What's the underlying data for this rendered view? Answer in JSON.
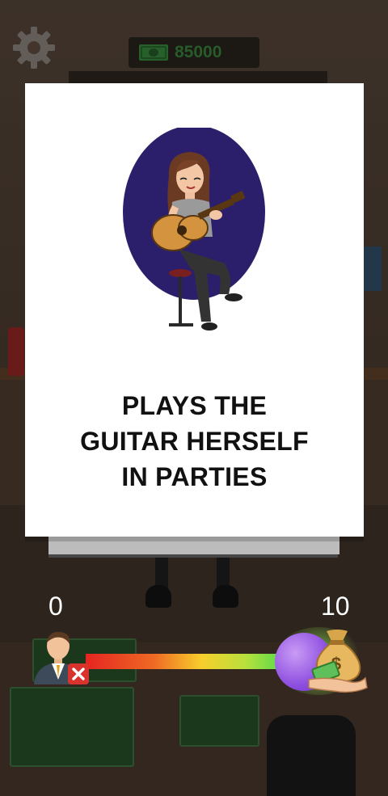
{
  "hud": {
    "money": "85000",
    "gear_icon": "gear-icon",
    "money_icon": "dollar-bill-icon"
  },
  "card": {
    "line1": "PLAYS THE",
    "line2": "GUITAR HERSELF",
    "line3": "IN PARTIES",
    "illustration": "woman-playing-guitar-illustration"
  },
  "score": {
    "min_label": "0",
    "max_label": "10"
  },
  "meter": {
    "left_icon": "businessman-avatar-icon",
    "left_badge_icon": "close-x-icon",
    "right_icon": "money-bag-hand-icon",
    "gradient_colors": [
      "#e52421",
      "#ef6a24",
      "#f7cf2c",
      "#b7e13d",
      "#4fd94c"
    ]
  },
  "colors": {
    "card_bg": "#ffffff",
    "oval_bg": "#2b1f6b",
    "money_text": "#275b29"
  }
}
